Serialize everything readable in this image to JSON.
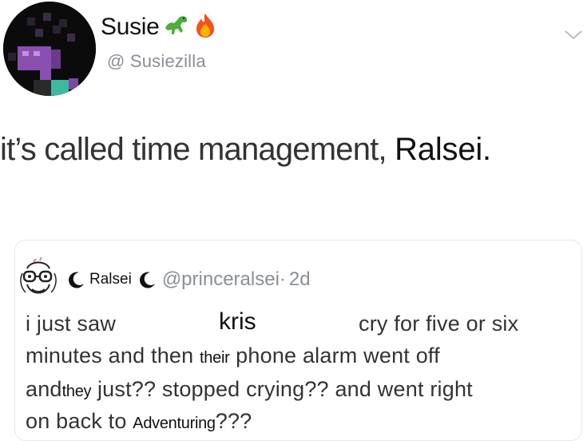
{
  "header": {
    "display_name": "Susie",
    "handle": "@ Susiezilla",
    "name_emojis": [
      "dinosaur-emoji",
      "fire-emoji"
    ]
  },
  "tweet": {
    "text_before": "it’s called time management,",
    "text_insert": "Ralsei."
  },
  "quoted_tweet": {
    "display_name": "Ralsei",
    "handle": "@princeralsei",
    "separator": "·",
    "time": "2d",
    "line1_a": "i just saw",
    "line1_name": "kris",
    "line1_b": "cry for five or six",
    "line2_a": "minutes and then",
    "line2_ins": "their",
    "line2_b": "phone alarm went off",
    "line3_a": "and",
    "line3_ins": "they",
    "line3_b": "just?? stopped crying?? and went right",
    "line4_a": "on back to",
    "line4_ins": "Adventuring",
    "line4_b": "???"
  },
  "colors": {
    "text_primary": "#111111",
    "text_body": "#333333",
    "text_secondary": "#8a8f96",
    "border": "#e6e8ea",
    "avatar_purple": "#8a4fb0",
    "avatar_teal": "#3fb8a0"
  }
}
